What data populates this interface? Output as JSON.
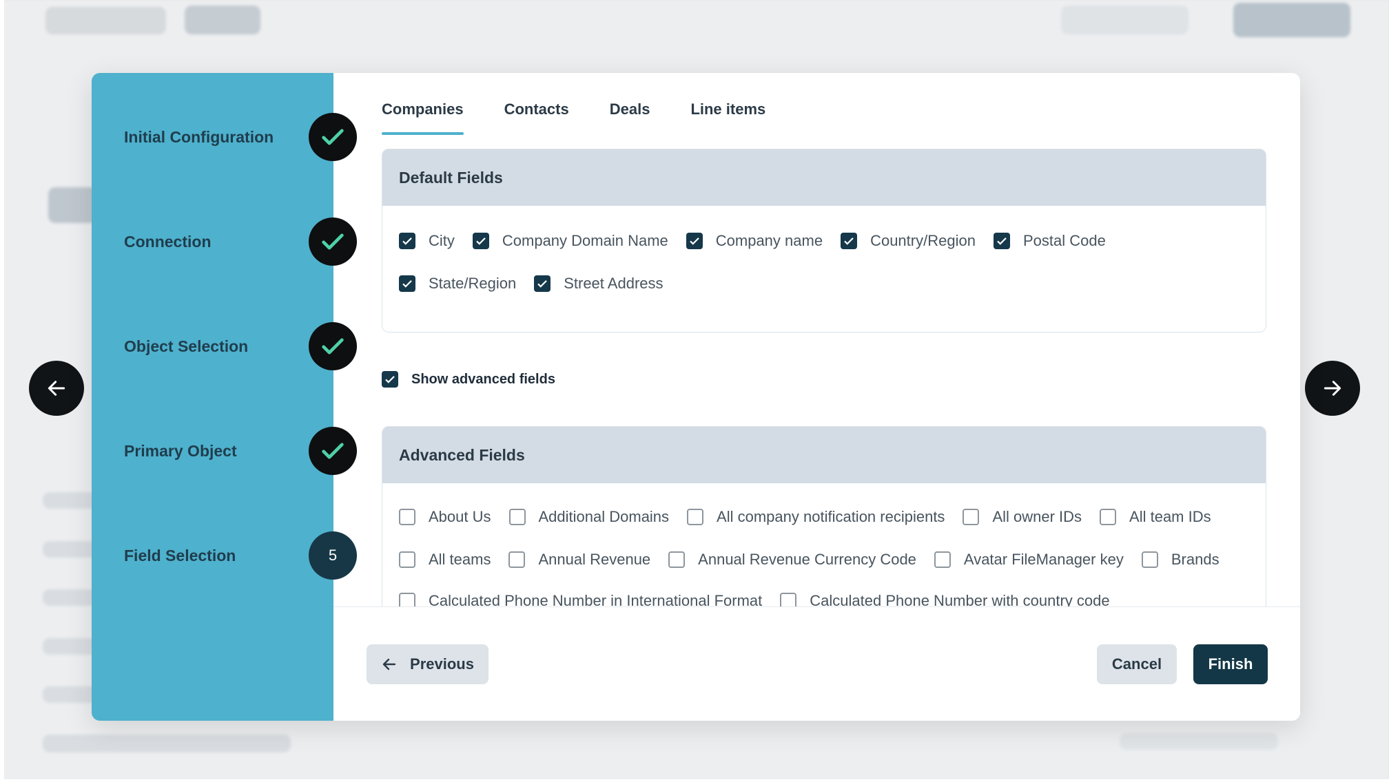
{
  "steps": [
    {
      "label": "Initial Configuration",
      "status": "done"
    },
    {
      "label": "Connection",
      "status": "done"
    },
    {
      "label": "Object Selection",
      "status": "done"
    },
    {
      "label": "Primary Object",
      "status": "done"
    },
    {
      "label": "Field Selection",
      "status": "current",
      "number": "5"
    }
  ],
  "tabs": [
    {
      "label": "Companies",
      "active": true
    },
    {
      "label": "Contacts",
      "active": false
    },
    {
      "label": "Deals",
      "active": false
    },
    {
      "label": "Line items",
      "active": false
    }
  ],
  "default_fields": {
    "title": "Default Fields",
    "rows": [
      [
        {
          "label": "City",
          "checked": true
        },
        {
          "label": "Company Domain Name",
          "checked": true
        },
        {
          "label": "Company name",
          "checked": true
        },
        {
          "label": "Country/Region",
          "checked": true
        },
        {
          "label": "Postal Code",
          "checked": true
        }
      ],
      [
        {
          "label": "State/Region",
          "checked": true
        },
        {
          "label": "Street Address",
          "checked": true
        }
      ]
    ]
  },
  "show_advanced": {
    "label": "Show advanced fields",
    "checked": true
  },
  "advanced_fields": {
    "title": "Advanced Fields",
    "rows": [
      [
        {
          "label": "About Us",
          "checked": false
        },
        {
          "label": "Additional Domains",
          "checked": false
        },
        {
          "label": "All company notification recipients",
          "checked": false
        },
        {
          "label": "All owner IDs",
          "checked": false
        },
        {
          "label": "All team IDs",
          "checked": false
        }
      ],
      [
        {
          "label": "All teams",
          "checked": false
        },
        {
          "label": "Annual Revenue",
          "checked": false
        },
        {
          "label": "Annual Revenue Currency Code",
          "checked": false
        },
        {
          "label": "Avatar FileManager key",
          "checked": false
        },
        {
          "label": "Brands",
          "checked": false
        }
      ],
      [
        {
          "label": "Calculated Phone Number in International Format",
          "checked": false
        },
        {
          "label": "Calculated Phone Number with country code",
          "checked": false
        }
      ]
    ]
  },
  "footer": {
    "previous": "Previous",
    "cancel": "Cancel",
    "finish": "Finish"
  },
  "colors": {
    "stepper_bg": "#4eb1cd",
    "primary_dark": "#133746",
    "check_green": "#4fd1a5"
  },
  "icons": {
    "step_done": "check-icon",
    "prev": "arrow-left-icon",
    "carousel_prev": "arrow-left-icon",
    "carousel_next": "arrow-right-icon"
  }
}
